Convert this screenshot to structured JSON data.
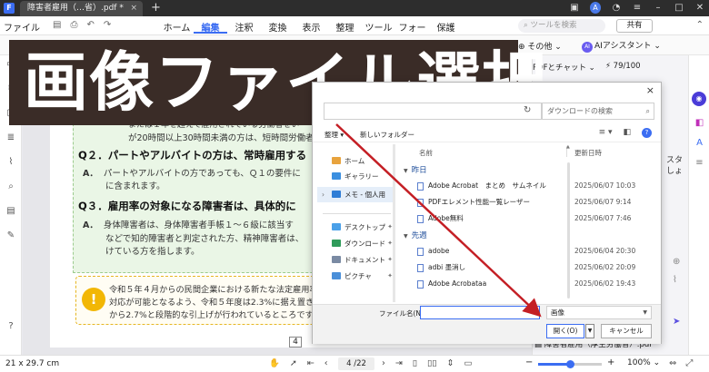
{
  "titlebar": {
    "tab_title": "障害者雇用（…省）.pdf *",
    "tab_close": "×",
    "new_tab": "+",
    "icons": [
      "folder-icon",
      "user-avatar",
      "notification-icon",
      "menu-icon",
      "minimize-icon",
      "maximize-icon",
      "close-icon"
    ],
    "avatar_letter": "A"
  },
  "menubar": {
    "file_label": "ファイル",
    "items": [
      "ホーム",
      "編集",
      "注釈",
      "変換",
      "表示",
      "整理",
      "ツール",
      "フォーム",
      "保護"
    ],
    "active_item": "編集",
    "search_placeholder": "ツールを検索",
    "share_label": "共有"
  },
  "subbar": {
    "other_label": "その他",
    "ai_label": "AIアシスタント"
  },
  "overlay": {
    "title": "画像ファイル選択"
  },
  "document": {
    "frag_line1": "または１年を超えて雇用されている労働者をい",
    "frag_line2": "が20時間以上30時間未満の方は、短時間労働者と",
    "q2": {
      "q": "Q２．パートやアルバイトの方は、常時雇用する",
      "a_mark": "A．",
      "a_line1": "パートやアルバイトの方であっても、Ｑ１の要件に",
      "a_line2": "に含まれます。"
    },
    "q3": {
      "q": "Q３．雇用率の対象になる障害者は、具体的に",
      "a_mark": "A．",
      "a_line1": "身体障害者は、身体障害者手帳１～６級に該当す",
      "a_line2": "などで知的障害者と判定された方、精神障害者は、",
      "a_line3": "けている方を指します。"
    },
    "note": {
      "icon": "!",
      "line1": "令和５年４月からの民間企業における新たな法定雇用率",
      "line2": "対応が可能となるよう、令和５年度は2.3%に据え置き、",
      "line3": "から2.7%と段階的な引上げが行われているところです。"
    },
    "page_number": "4"
  },
  "rightpanel": {
    "tab1": "PDFとチャット",
    "tab2": "79/100",
    "cut1": "スタ",
    "cut2": "しょ",
    "file_label": "障害者雇用（厚生労働省）.pdf"
  },
  "dialog": {
    "close": "×",
    "search_placeholder": "ダウンロードの検索",
    "organize": "整理",
    "new_folder": "新しいフォルダー",
    "nav": [
      {
        "label": "ホーム",
        "color": "#e8a33d"
      },
      {
        "label": "ギャラリー",
        "color": "#3b8fe0"
      },
      {
        "label": "メモ - 個人用",
        "color": "#2f7dd6"
      },
      {
        "label": "デスクトップ",
        "color": "#4aa0e8"
      },
      {
        "label": "ダウンロード",
        "color": "#2f9b5a"
      },
      {
        "label": "ドキュメント",
        "color": "#7a8aa3"
      },
      {
        "label": "ピクチャ",
        "color": "#4a8fd9"
      }
    ],
    "columns": {
      "name": "名前",
      "date": "更新日時"
    },
    "groups": {
      "yesterday": "昨日",
      "last_week": "先週"
    },
    "files_yesterday": [
      {
        "name": "Adobe Acrobat　まとめ　サムネイル",
        "date": "2025/06/07 10:03"
      },
      {
        "name": "PDFエレメント性能一覧レーザー",
        "date": "2025/06/07 9:14"
      },
      {
        "name": "Adobe無料",
        "date": "2025/06/07 7:46"
      }
    ],
    "files_last_week": [
      {
        "name": "adobe",
        "date": "2025/06/04 20:30"
      },
      {
        "name": "adbi 墨消し",
        "date": "2025/06/02 20:09"
      },
      {
        "name": "Adobe Acrobataa",
        "date": "2025/06/02 19:43"
      }
    ],
    "filename_label": "ファイル名(N):",
    "filename_value": "",
    "filetype": "画像",
    "open_label": "開く(O)",
    "cancel_label": "キャンセル"
  },
  "statusbar": {
    "page_size": "21 x 29.7 cm",
    "page_indicator": "4 /22",
    "zoom": "100%",
    "zoom_fraction": 0.5
  },
  "accent_color": "#3b6df2",
  "arrow_color": "#c41f25"
}
